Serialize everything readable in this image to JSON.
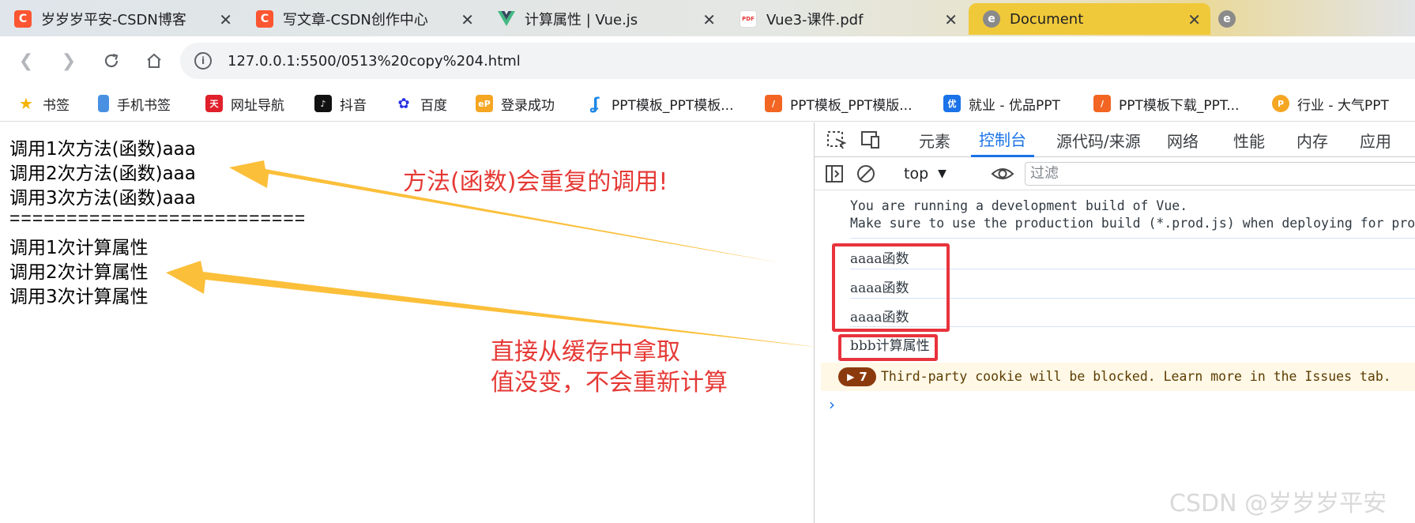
{
  "tabs": [
    {
      "title": "岁岁岁平安-CSDN博客",
      "icon": "csdn-icon",
      "color": "#fc5531"
    },
    {
      "title": "写文章-CSDN创作中心",
      "icon": "csdn-icon",
      "color": "#fc5531"
    },
    {
      "title": "计算属性 | Vue.js",
      "icon": "vue-icon",
      "color": "#42b883"
    },
    {
      "title": "Vue3-课件.pdf",
      "icon": "pdf-icon",
      "color": "#e53935"
    },
    {
      "title": "Document",
      "icon": "document-icon",
      "color": "#8a8a8a"
    }
  ],
  "address": {
    "url": "127.0.0.1:5500/0513%20copy%204.html"
  },
  "bookmarks": [
    {
      "label": "书签",
      "icon": "star-icon"
    },
    {
      "label": "手机书签",
      "icon": "phone-icon"
    },
    {
      "label": "网址导航",
      "icon": "navigation-icon"
    },
    {
      "label": "抖音",
      "icon": "douyin-icon"
    },
    {
      "label": "百度",
      "icon": "baidu-icon"
    },
    {
      "label": "登录成功",
      "icon": "ep-icon"
    },
    {
      "label": "PPT模板_PPT模板...",
      "icon": "ppt-icon"
    },
    {
      "label": "PPT模板_PPT模版...",
      "icon": "ppt-icon"
    },
    {
      "label": "就业 - 优品PPT",
      "icon": "youpin-icon"
    },
    {
      "label": "PPT模板下载_PPT...",
      "icon": "ppt-icon"
    },
    {
      "label": "行业 - 大气PPT",
      "icon": "p-icon"
    }
  ],
  "page": {
    "lines": [
      "调用1次方法(函数)aaa",
      "调用2次方法(函数)aaa",
      "调用3次方法(函数)aaa",
      "==========================",
      "调用1次计算属性",
      "调用2次计算属性",
      "调用3次计算属性"
    ],
    "annotation_method": "方法(函数)会重复的调用!",
    "annotation_cache_1": "直接从缓存中拿取",
    "annotation_cache_2": "值没变，不会重新计算",
    "watermark": "CSDN @岁岁岁平安"
  },
  "devtools": {
    "tabs": [
      "元素",
      "控制台",
      "源代码/来源",
      "网络",
      "性能",
      "内存",
      "应用"
    ],
    "active_tab": "控制台",
    "context": "top",
    "filter_placeholder": "过滤",
    "console": {
      "vue_warning_1": "You are running a development build of Vue.",
      "vue_warning_2": "Make sure to use the production build (*.prod.js) when deploying for pro",
      "logs": [
        "aaaa函数",
        "aaaa函数",
        "aaaa函数",
        "bbb计算属性"
      ],
      "issues_count": "7",
      "issues_text": "Third-party cookie will be blocked. Learn more in the Issues tab."
    }
  },
  "colors": {
    "accent": "#1a73e8",
    "annotation": "#e53935",
    "arrow": "#fbbf3a",
    "highlight_box": "#e8333d"
  }
}
